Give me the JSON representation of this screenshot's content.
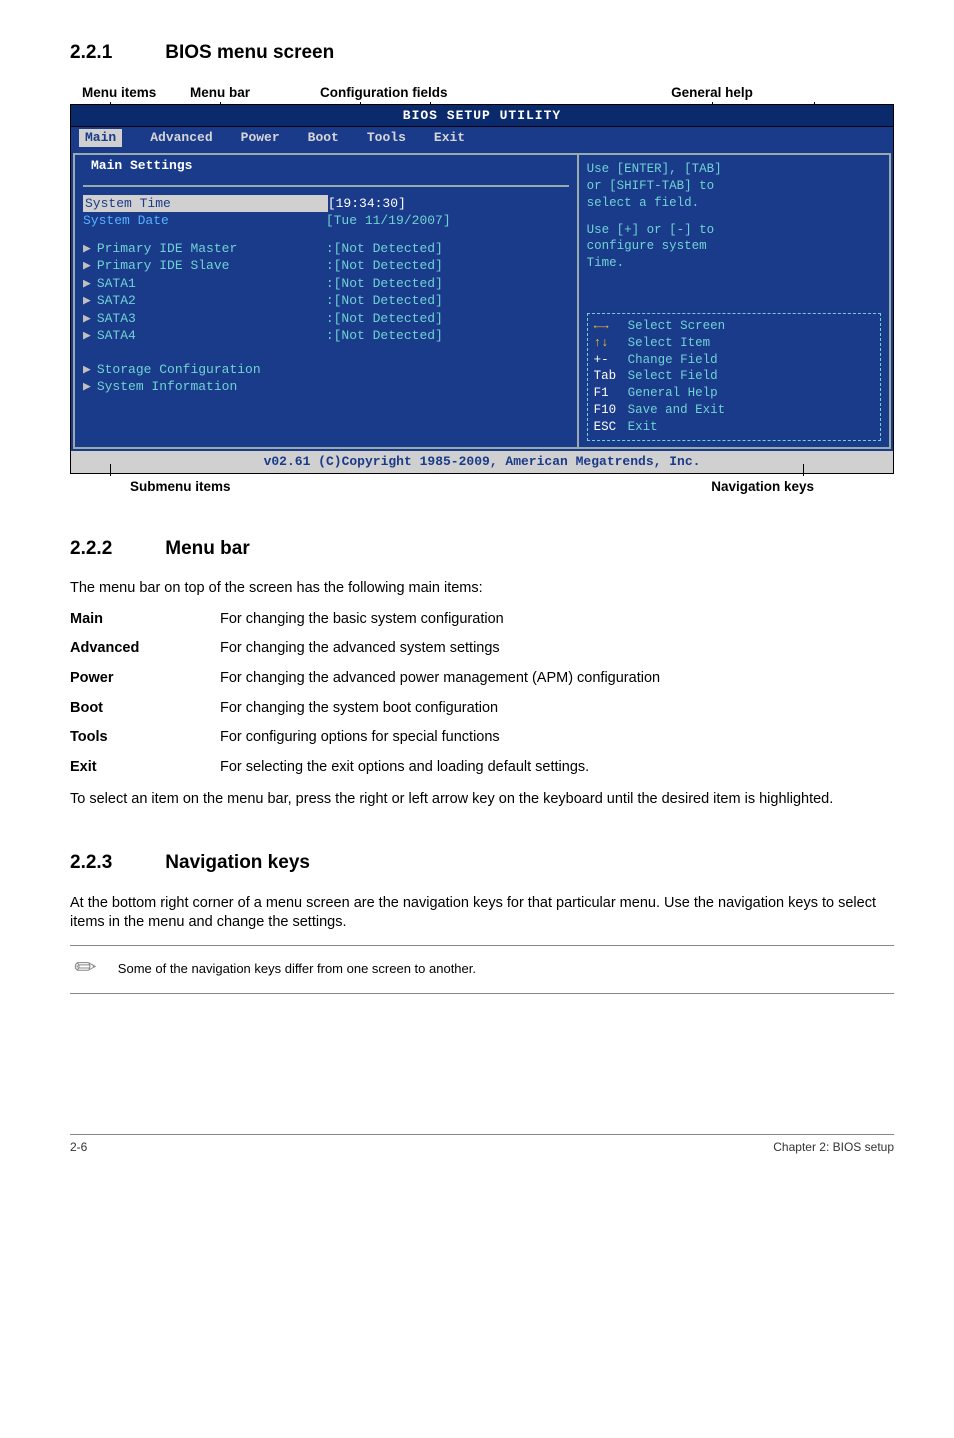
{
  "s221": {
    "num": "2.2.1",
    "title": "BIOS menu screen",
    "labels": {
      "menu_items": "Menu items",
      "menu_bar": "Menu bar",
      "config_fields": "Configuration fields",
      "general_help": "General help",
      "submenu_items": "Submenu items",
      "nav_keys": "Navigation keys"
    }
  },
  "bios": {
    "title": "BIOS SETUP UTILITY",
    "tabs": [
      "Main",
      "Advanced",
      "Power",
      "Boot",
      "Tools",
      "Exit"
    ],
    "section_title": "Main Settings",
    "rows": {
      "system_time_lbl": "System Time",
      "system_time_val": "[19:34:30]",
      "system_date_lbl": "System Date",
      "system_date_val": "[Tue 11/19/2007]",
      "pide_master": "Primary IDE Master",
      "pide_slave": "Primary IDE Slave",
      "sata1": "SATA1",
      "sata2": "SATA2",
      "sata3": "SATA3",
      "sata4": "SATA4",
      "nd": ":[Not Detected]",
      "storage_cfg": "Storage Configuration",
      "sys_info": "System Information"
    },
    "help": {
      "l1": "Use [ENTER], [TAB]",
      "l2": "or [SHIFT-TAB] to",
      "l3": "select a field.",
      "l4": "Use [+] or [-] to",
      "l5": "configure system",
      "l6": "Time."
    },
    "nav": {
      "r1": "Select Screen",
      "r2": "Select Item",
      "r3k": "+-",
      "r3": "Change Field",
      "r4k": "Tab",
      "r4": "Select Field",
      "r5k": "F1",
      "r5": "General Help",
      "r6k": "F10",
      "r6": "Save and Exit",
      "r7k": "ESC",
      "r7": "Exit"
    },
    "footer": "v02.61 (C)Copyright 1985-2009, American Megatrends, Inc."
  },
  "s222": {
    "num": "2.2.2",
    "title": "Menu bar",
    "intro": "The menu bar on top of the screen has the following main items:",
    "rows": {
      "main_k": "Main",
      "main_v": "For changing the basic system configuration",
      "adv_k": "Advanced",
      "adv_v": "For changing the advanced system settings",
      "pow_k": "Power",
      "pow_v": "For changing the advanced power management (APM) configuration",
      "boot_k": "Boot",
      "boot_v": "For changing the system boot configuration",
      "tools_k": "Tools",
      "tools_v": "For configuring options for special functions",
      "exit_k": "Exit",
      "exit_v": "For selecting the exit options and loading default settings."
    },
    "outro": "To select an item on the menu bar, press the right or left arrow key on the keyboard until the desired item is highlighted."
  },
  "s223": {
    "num": "2.2.3",
    "title": "Navigation keys",
    "body": "At the bottom right corner of a menu screen are the navigation keys for that particular menu. Use the navigation keys to select items in the menu and change the settings.",
    "note": "Some of the navigation keys differ from one screen to another."
  },
  "footer": {
    "left": "2-6",
    "right": "Chapter 2: BIOS setup"
  }
}
